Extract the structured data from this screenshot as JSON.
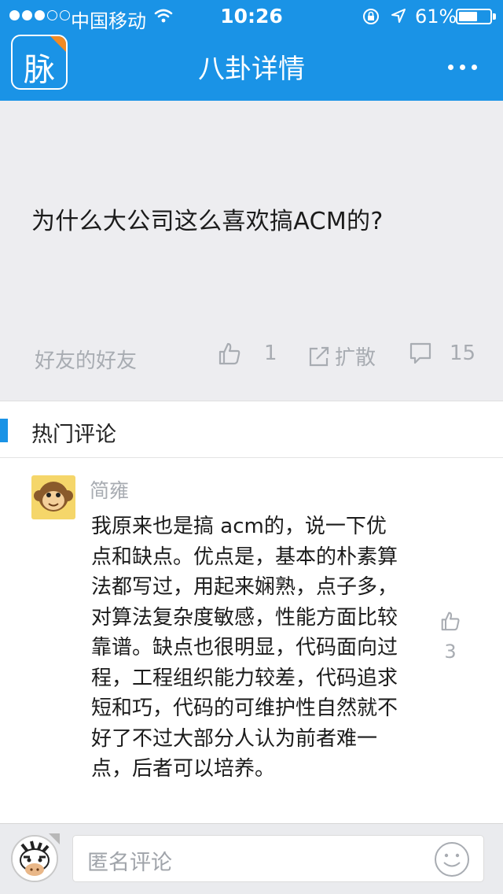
{
  "status_bar": {
    "carrier": "中国移动",
    "time": "10:26",
    "battery_percent": "61%",
    "battery_level": 0.61
  },
  "header": {
    "logo_text": "脉",
    "title": "八卦详情"
  },
  "post": {
    "question": "为什么大公司这么喜欢搞ACM的?",
    "source": "好友的好友",
    "like_count": "1",
    "share_label": "扩散",
    "comment_count": "15"
  },
  "hot_comments": {
    "title": "热门评论",
    "items": [
      {
        "author": "简雍",
        "text": "我原来也是搞 acm的，说一下优点和缺点。优点是，基本的朴素算法都写过，用起来娴熟，点子多，对算法复杂度敏感，性能方面比较靠谱。缺点也很明显，代码面向过程，工程组织能力较差，代码追求短和巧，代码的可维护性自然就不好了不过大部分人认为前者难一点，后者可以培养。",
        "likes": "3"
      }
    ]
  },
  "composer": {
    "placeholder": "匿名评论"
  },
  "colors": {
    "brand_blue": "#1a93e6",
    "accent_orange": "#f08a24",
    "muted_text": "#a8acb2"
  },
  "icons": [
    "wifi-icon",
    "rotation-lock-icon",
    "location-icon",
    "thumbs-up-icon",
    "share-icon",
    "comment-icon",
    "smiley-icon",
    "monkey-avatar",
    "zebra-avatar"
  ]
}
